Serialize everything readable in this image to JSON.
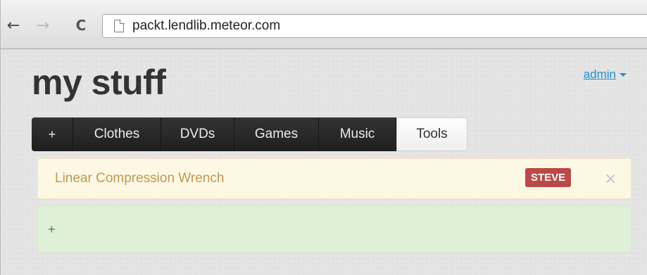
{
  "browser": {
    "back_glyph": "←",
    "forward_glyph": "→",
    "reload_glyph": "C",
    "url": "packt.lendlib.meteor.com"
  },
  "header": {
    "title": "my stuff",
    "user_menu_label": "admin"
  },
  "tabs": [
    {
      "label": "+"
    },
    {
      "label": "Clothes"
    },
    {
      "label": "DVDs"
    },
    {
      "label": "Games"
    },
    {
      "label": "Music"
    },
    {
      "label": "Tools",
      "active": true
    }
  ],
  "items": [
    {
      "name": "Linear Compression Wrench",
      "owner_badge": "STEVE",
      "remove_glyph": "×"
    }
  ],
  "add_item": {
    "label": "+"
  },
  "colors": {
    "accent_link": "#1a8fd2",
    "badge_red": "#b94a48",
    "item_warning_bg": "#fcf8e3",
    "add_success_bg": "#dff0d8"
  }
}
